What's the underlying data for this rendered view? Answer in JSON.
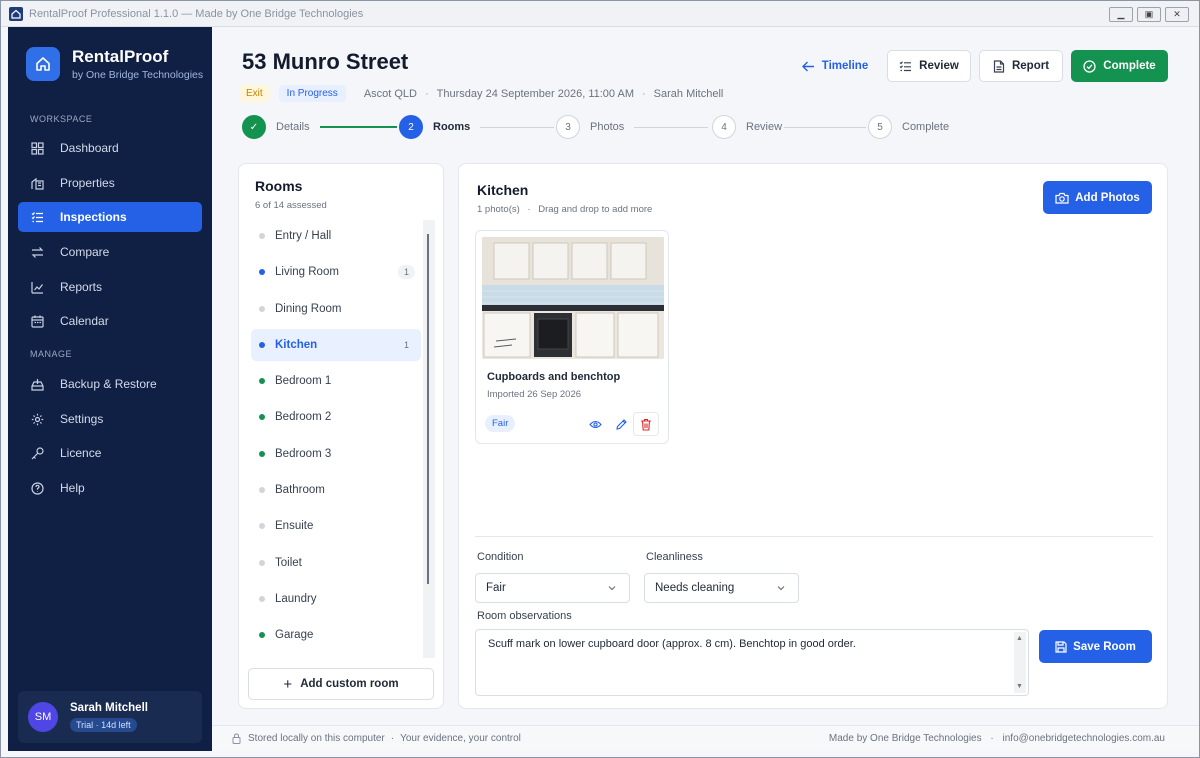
{
  "window": {
    "title": "RentalProof Professional 1.1.0 — Made by One Bridge Technologies"
  },
  "brand": {
    "name": "RentalProof",
    "tagline": "by One Bridge Technologies"
  },
  "sidebar": {
    "workspace_label": "WORKSPACE",
    "manage_label": "MANAGE",
    "workspace_items": [
      {
        "label": "Dashboard",
        "icon": "grid-icon"
      },
      {
        "label": "Properties",
        "icon": "building-icon"
      },
      {
        "label": "Inspections",
        "icon": "checklist-icon",
        "active": true
      },
      {
        "label": "Compare",
        "icon": "swap-icon"
      },
      {
        "label": "Reports",
        "icon": "chart-icon"
      },
      {
        "label": "Calendar",
        "icon": "calendar-icon"
      }
    ],
    "manage_items": [
      {
        "label": "Backup & Restore",
        "icon": "backup-icon"
      },
      {
        "label": "Settings",
        "icon": "gear-icon"
      },
      {
        "label": "Licence",
        "icon": "key-icon"
      },
      {
        "label": "Help",
        "icon": "help-icon"
      }
    ],
    "user": {
      "initials": "SM",
      "name": "Sarah Mitchell",
      "badge": "Trial · 14d left"
    }
  },
  "header": {
    "title": "53 Munro Street",
    "type_badge": "Exit",
    "status_badge": "In Progress",
    "suburb": "Ascot QLD",
    "datetime": "Thursday 24 September 2026, 11:00 AM",
    "inspector": "Sarah Mitchell",
    "timeline_label": "Timeline",
    "review_label": "Review",
    "report_label": "Report",
    "complete_label": "Complete"
  },
  "stepper": [
    {
      "num": "✓",
      "label": "Details",
      "state": "done"
    },
    {
      "num": "2",
      "label": "Rooms",
      "state": "current"
    },
    {
      "num": "3",
      "label": "Photos",
      "state": "todo"
    },
    {
      "num": "4",
      "label": "Review",
      "state": "todo"
    },
    {
      "num": "5",
      "label": "Complete",
      "state": "todo"
    }
  ],
  "rooms": {
    "title": "Rooms",
    "subtitle": "6 of 14 assessed",
    "items": [
      {
        "label": "Entry / Hall",
        "status": "none",
        "count": ""
      },
      {
        "label": "Living Room",
        "status": "blue",
        "count": "1"
      },
      {
        "label": "Dining Room",
        "status": "none",
        "count": ""
      },
      {
        "label": "Kitchen",
        "status": "blue",
        "count": "1",
        "active": true
      },
      {
        "label": "Bedroom 1",
        "status": "green",
        "count": ""
      },
      {
        "label": "Bedroom 2",
        "status": "green",
        "count": ""
      },
      {
        "label": "Bedroom 3",
        "status": "green",
        "count": ""
      },
      {
        "label": "Bathroom",
        "status": "none",
        "count": ""
      },
      {
        "label": "Ensuite",
        "status": "none",
        "count": ""
      },
      {
        "label": "Toilet",
        "status": "none",
        "count": ""
      },
      {
        "label": "Laundry",
        "status": "none",
        "count": ""
      },
      {
        "label": "Garage",
        "status": "green",
        "count": ""
      }
    ],
    "add_label": "Add custom room"
  },
  "room_detail": {
    "title": "Kitchen",
    "photo_count": "1 photo(s)",
    "hint": "Drag and drop to add more",
    "add_photos_label": "Add Photos",
    "photo": {
      "caption": "Cupboards and benchtop",
      "date": "Imported 26 Sep 2026",
      "condition": "Fair"
    },
    "condition_label": "Condition",
    "condition_value": "Fair",
    "cleanliness_label": "Cleanliness",
    "cleanliness_value": "Needs cleaning",
    "observations_label": "Room observations",
    "observations_text": "Scuff mark on lower cupboard door (approx. 8 cm). Benchtop in good order.",
    "save_label": "Save Room"
  },
  "footer": {
    "left": "Stored locally on this computer",
    "left2": "Your evidence, your control",
    "right": "Made by One Bridge Technologies",
    "email": "info@onebridgetechnologies.com.au"
  },
  "colors": {
    "accent": "#2461e6",
    "sidebar": "#101f44",
    "success": "#14924f"
  }
}
